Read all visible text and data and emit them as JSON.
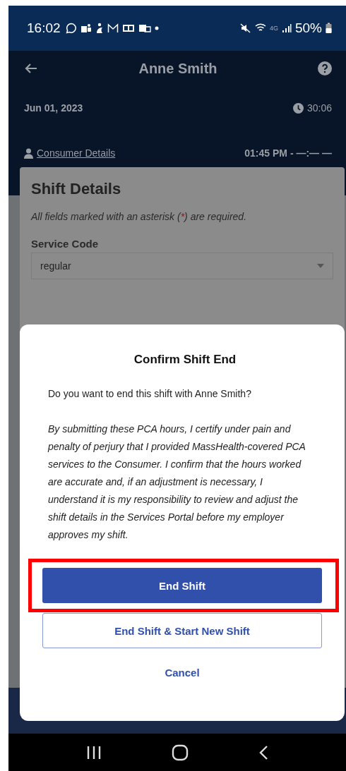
{
  "status_bar": {
    "time": "16:02",
    "network": "4G",
    "battery": "50%"
  },
  "header": {
    "title": "Anne Smith",
    "date": "Jun 01, 2023",
    "timer": "30:06",
    "consumer_link": "Consumer Details",
    "time_range": "01:45 PM - —:— —"
  },
  "shift_details": {
    "title": "Shift Details",
    "note": [
      "All fields marked with an asterisk (",
      "*",
      ") are required."
    ],
    "service_code": {
      "label": "Service Code",
      "value": "regular"
    }
  },
  "dialog": {
    "title": "Confirm Shift End",
    "question": "Do you want to end this shift with  Anne Smith?",
    "disclaimer": "By submitting these PCA hours, I certify under pain and penalty of perjury that I provided MassHealth-covered PCA services to the Consumer.  I confirm that the hours worked are accurate and, if an adjustment is necessary, I understand it is my responsibility to review and adjust the shift details in the Services Portal before my employer approves my shift.",
    "buttons": [
      {
        "label": "End Shift",
        "kind": "primary",
        "highlighted": true
      },
      {
        "label": "End Shift & Start New Shift",
        "kind": "outline",
        "highlighted": false
      },
      {
        "label": "Cancel",
        "kind": "text",
        "highlighted": false
      }
    ]
  }
}
